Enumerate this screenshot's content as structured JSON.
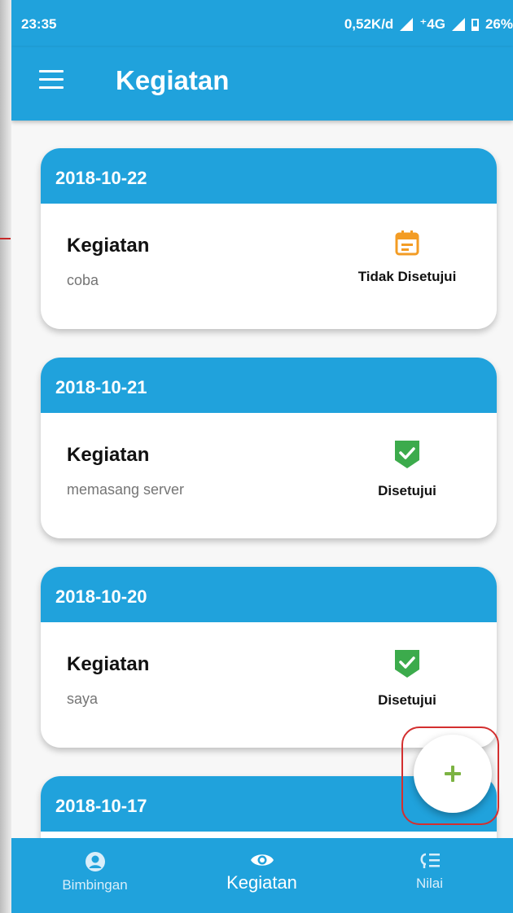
{
  "status_bar": {
    "time": "23:35",
    "speed": "0,52K/d",
    "network": "⁺4G",
    "battery": "26%"
  },
  "app_bar": {
    "title": "Kegiatan",
    "menu_icon": "hamburger-menu-icon"
  },
  "activities": [
    {
      "date": "2018-10-22",
      "title": "Kegiatan",
      "description": "coba",
      "status": "Tidak Disetujui",
      "status_icon": "calendar-icon",
      "status_color": "#f39c24"
    },
    {
      "date": "2018-10-21",
      "title": "Kegiatan",
      "description": "memasang server",
      "status": "Disetujui",
      "status_icon": "shield-check-icon",
      "status_color": "#3cab4c"
    },
    {
      "date": "2018-10-20",
      "title": "Kegiatan",
      "description": "saya",
      "status": "Disetujui",
      "status_icon": "shield-check-icon",
      "status_color": "#3cab4c"
    },
    {
      "date": "2018-10-17"
    }
  ],
  "fab": {
    "icon": "plus-icon",
    "color": "#7cb342"
  },
  "bottom_nav": {
    "items": [
      {
        "label": "Bimbingan",
        "icon": "person-circle-icon"
      },
      {
        "label": "Kegiatan",
        "icon": "eye-icon",
        "active": true
      },
      {
        "label": "Nilai",
        "icon": "list-icon"
      }
    ]
  },
  "colors": {
    "primary": "#20a2dc",
    "background": "#f7f7f7",
    "highlight_ring": "#d32f2f"
  }
}
